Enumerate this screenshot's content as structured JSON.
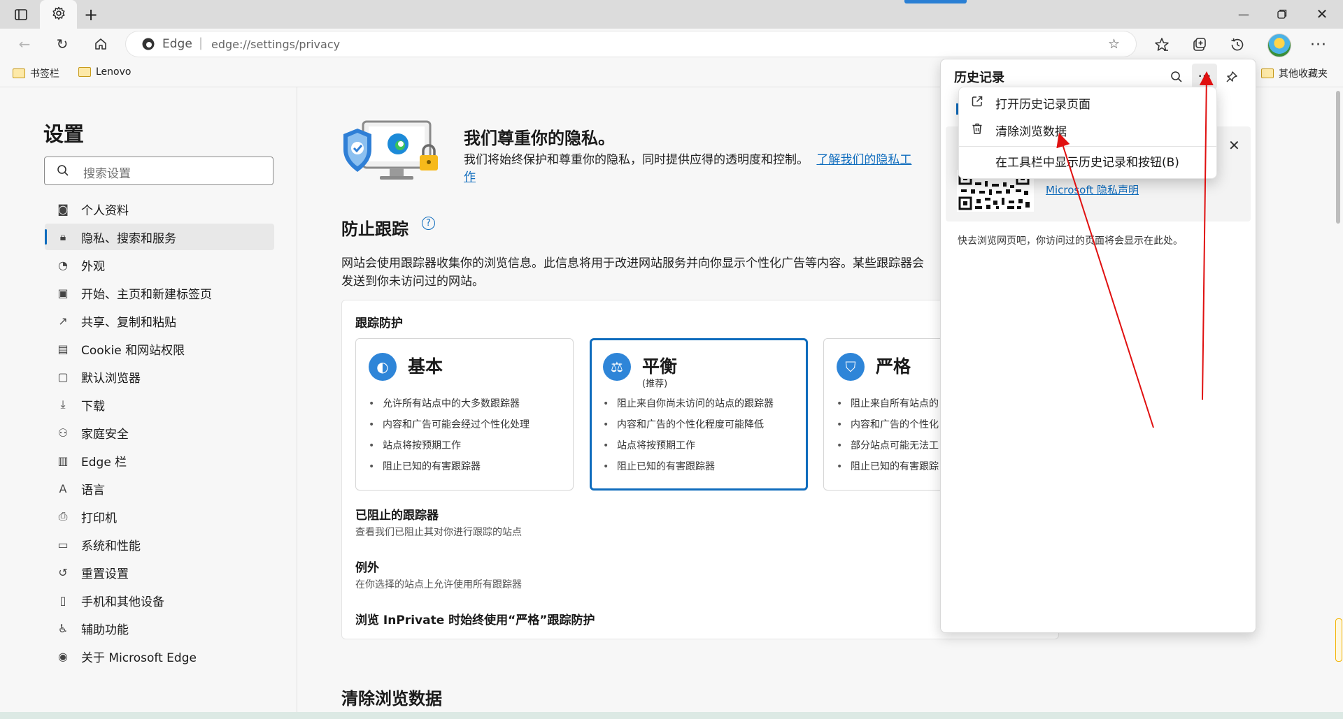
{
  "browser": {
    "address_brand": "Edge",
    "address_url": "edge://settings/privacy",
    "window_controls": [
      "minimize",
      "restore",
      "close"
    ]
  },
  "bookmarks": {
    "items": [
      "书签栏",
      "Lenovo"
    ],
    "other": "其他收藏夹"
  },
  "sidebar": {
    "title": "设置",
    "search_placeholder": "搜索设置",
    "items": [
      {
        "label": "个人资料",
        "icon": "profile-icon"
      },
      {
        "label": "隐私、搜索和服务",
        "icon": "lock-icon",
        "active": true
      },
      {
        "label": "外观",
        "icon": "palette-icon"
      },
      {
        "label": "开始、主页和新建标签页",
        "icon": "home-tab-icon"
      },
      {
        "label": "共享、复制和粘贴",
        "icon": "share-icon"
      },
      {
        "label": "Cookie 和网站权限",
        "icon": "cookie-icon"
      },
      {
        "label": "默认浏览器",
        "icon": "browser-icon"
      },
      {
        "label": "下载",
        "icon": "download-icon"
      },
      {
        "label": "家庭安全",
        "icon": "family-icon"
      },
      {
        "label": "Edge 栏",
        "icon": "edge-bar-icon"
      },
      {
        "label": "语言",
        "icon": "language-icon"
      },
      {
        "label": "打印机",
        "icon": "printer-icon"
      },
      {
        "label": "系统和性能",
        "icon": "laptop-icon"
      },
      {
        "label": "重置设置",
        "icon": "reset-icon"
      },
      {
        "label": "手机和其他设备",
        "icon": "phone-icon"
      },
      {
        "label": "辅助功能",
        "icon": "accessibility-icon"
      },
      {
        "label": "关于 Microsoft Edge",
        "icon": "edge-logo-icon"
      }
    ]
  },
  "privacy": {
    "heading": "我们尊重你的隐私。",
    "desc": "我们将始终保护和尊重你的隐私，同时提供应得的透明度和控制。",
    "link_part1": "了解我们的隐私工",
    "link_part2": "作"
  },
  "tracking": {
    "heading": "防止跟踪",
    "desc_line1": "网站会使用跟踪器收集你的浏览信息。此信息将用于改进网站服务并向你显示个性化广告等内容。某些跟踪器会",
    "desc_line2": "发送到你未访问过的网站。",
    "card_title": "跟踪防护",
    "modes": [
      {
        "title": "基本",
        "subtitle": "",
        "bullets": [
          "允许所有站点中的大多数跟踪器",
          "内容和广告可能会经过个性化处理",
          "站点将按预期工作",
          "阻止已知的有害跟踪器"
        ]
      },
      {
        "title": "平衡",
        "subtitle": "(推荐)",
        "bullets": [
          "阻止来自你尚未访问的站点的跟踪器",
          "内容和广告的个性化程度可能降低",
          "站点将按预期工作",
          "阻止已知的有害跟踪器"
        ]
      },
      {
        "title": "严格",
        "subtitle": "",
        "bullets": [
          "阻止来自所有站点的",
          "内容和广告的个性化",
          "部分站点可能无法工",
          "阻止已知的有害跟踪"
        ]
      }
    ],
    "blocked_title": "已阻止的跟踪器",
    "blocked_desc": "查看我们已阻止其对你进行跟踪的站点",
    "exceptions_title": "例外",
    "exceptions_desc": "在你选择的站点上允许使用所有跟踪器",
    "inprivate": "浏览 InPrivate 时始终使用“严格”跟踪防护"
  },
  "clear": {
    "heading": "清除浏览数据"
  },
  "history_panel": {
    "title": "历史记录",
    "privacy_link": "Microsoft 隐私声明",
    "empty_text": "快去浏览网页吧，你访问过的页面将会显示在此处。"
  },
  "history_menu": {
    "items": [
      {
        "label": "打开历史记录页面",
        "icon": "open-external-icon"
      },
      {
        "label": "清除浏览数据",
        "icon": "trash-icon"
      },
      {
        "label": "在工具栏中显示历史记录和按钮(B)",
        "icon": ""
      }
    ]
  },
  "colors": {
    "accent": "#0f6cbd",
    "annotation": "#e01010",
    "selected_border": "#0f6cbd"
  }
}
